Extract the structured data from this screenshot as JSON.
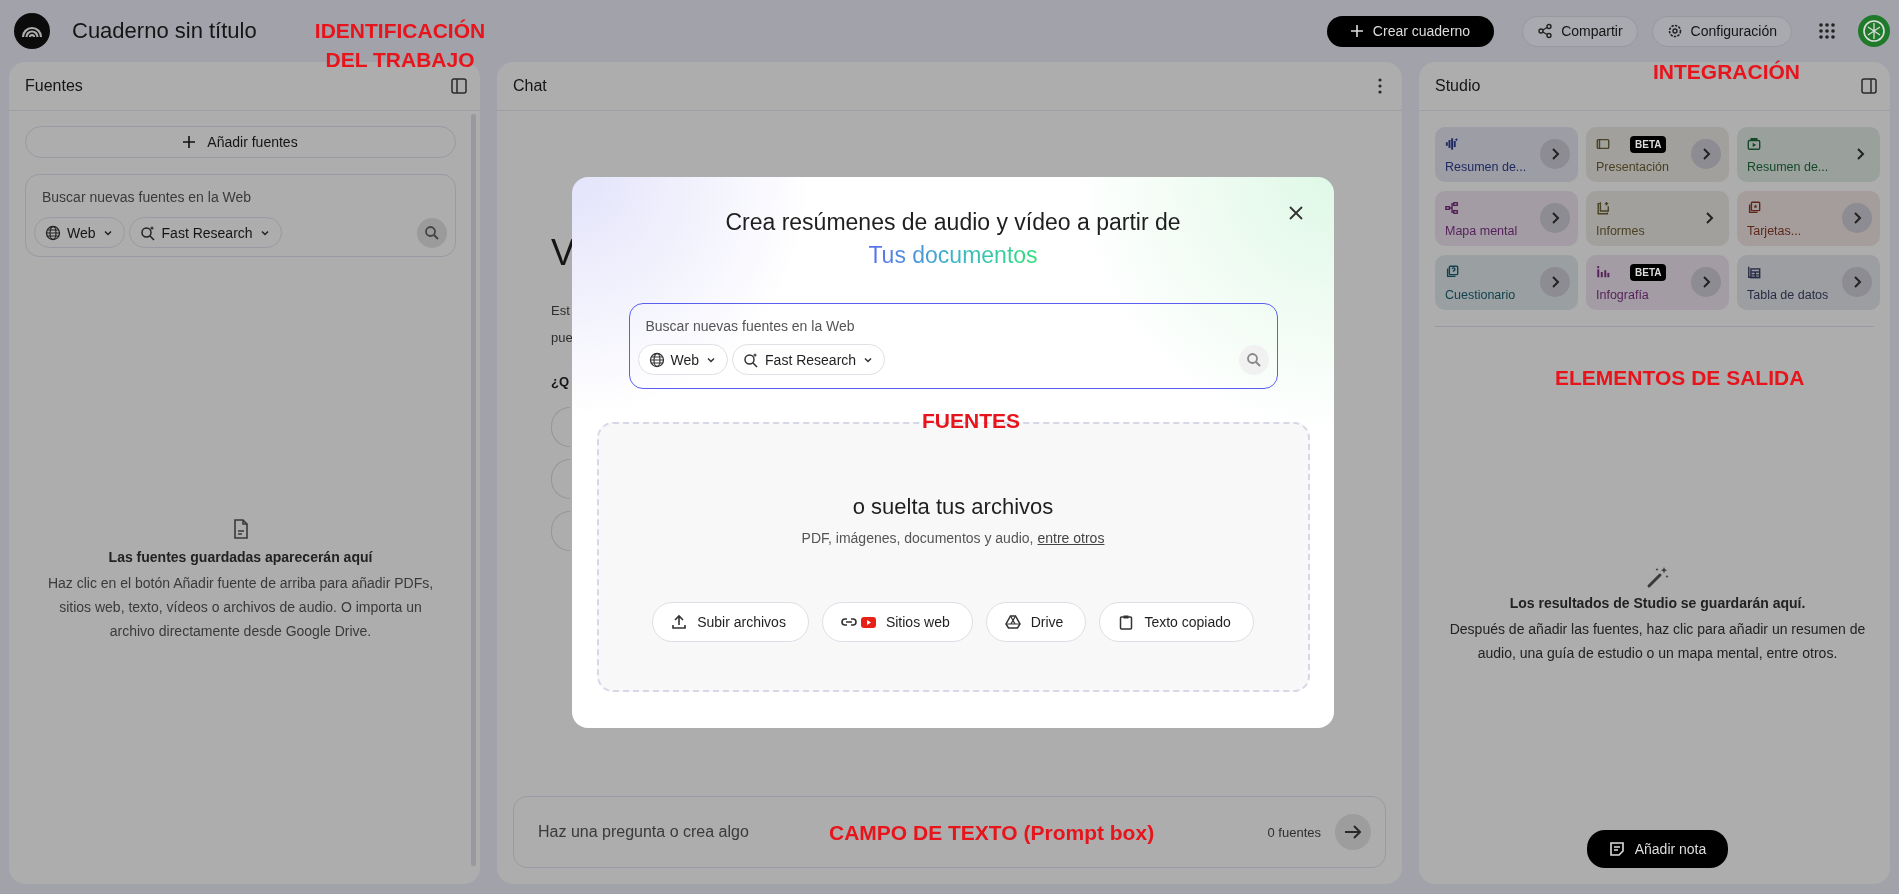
{
  "header": {
    "notebook_title": "Cuaderno sin título",
    "create_button": "Crear cuaderno",
    "share_button": "Compartir",
    "settings_button": "Configuración"
  },
  "sources_panel": {
    "title": "Fuentes",
    "add_button": "Añadir fuentes",
    "search": {
      "placeholder": "Buscar nuevas fuentes en la Web",
      "source_chip": "Web",
      "mode_chip": "Fast Research"
    },
    "empty_title": "Las fuentes guardadas aparecerán aquí",
    "empty_text": "Haz clic en el botón Añadir fuente de arriba para añadir PDFs, sitios web, texto, vídeos o archivos de audio. O importa un archivo directamente desde Google Drive."
  },
  "chat_panel": {
    "title": "Chat",
    "fragments": [
      {
        "kind": "heading",
        "text": "V"
      },
      {
        "kind": "line",
        "text": "Est"
      },
      {
        "kind": "line",
        "text": "pue"
      },
      {
        "kind": "question",
        "text": "¿Q"
      }
    ],
    "prompt": {
      "placeholder": "Haz una pregunta o crea algo",
      "source_count": "0 fuentes"
    }
  },
  "studio_panel": {
    "title": "Studio",
    "cards": [
      {
        "label": "Resumen de...",
        "kind": "audio",
        "color": "#1f2a61",
        "circled": true
      },
      {
        "label": "Presentación",
        "kind": "slides",
        "badge": "BETA",
        "color": "#4a4123",
        "circled": true
      },
      {
        "label": "Resumen de...",
        "kind": "video",
        "color": "#154829",
        "circled": false
      },
      {
        "label": "Mapa mental",
        "kind": "mindmap",
        "color": "#551f5a",
        "circled": true
      },
      {
        "label": "Informes",
        "kind": "report",
        "color": "#4a4123",
        "circled": false
      },
      {
        "label": "Tarjetas...",
        "kind": "flashcards",
        "color": "#5e271a",
        "circled": true
      },
      {
        "label": "Cuestionario",
        "kind": "quiz",
        "color": "#12414e",
        "circled": true
      },
      {
        "label": "Infografía",
        "kind": "infographic",
        "badge": "BETA",
        "color": "#551f5a",
        "circled": true
      },
      {
        "label": "Tabla de datos",
        "kind": "table",
        "color": "#282c45",
        "circled": true
      }
    ],
    "empty_title": "Los resultados de Studio se guardarán aquí.",
    "empty_text": "Después de añadir las fuentes, haz clic para añadir un resumen de audio, una guía de estudio o un mapa mental, entre otros.",
    "note_button": "Añadir nota"
  },
  "modal": {
    "title": "Crea resúmenes de audio y vídeo a partir de",
    "highlight": "Tus documentos",
    "search": {
      "placeholder": "Buscar nuevas fuentes en la Web",
      "source_chip": "Web",
      "mode_chip": "Fast Research"
    },
    "drop_title": "o suelta tus archivos",
    "drop_text": "PDF, imágenes, documentos y audio,",
    "drop_link": "entre otros",
    "buttons": [
      {
        "label": "Subir archivos",
        "kind": "upload"
      },
      {
        "label": "Sitios web",
        "kind": "web"
      },
      {
        "label": "Drive",
        "kind": "drive"
      },
      {
        "label": "Texto copiado",
        "kind": "clipboard"
      }
    ]
  },
  "annotations": [
    {
      "kind": "title",
      "text": "IDENTIFICACIÓN DEL TRABAJO"
    },
    {
      "kind": "integration",
      "text": "INTEGRACIÓN"
    },
    {
      "kind": "output",
      "text": "ELEMENTOS DE SALIDA"
    },
    {
      "kind": "sources",
      "text": "FUENTES"
    },
    {
      "kind": "prompt",
      "text": "CAMPO DE TEXTO (Prompt box)"
    }
  ]
}
